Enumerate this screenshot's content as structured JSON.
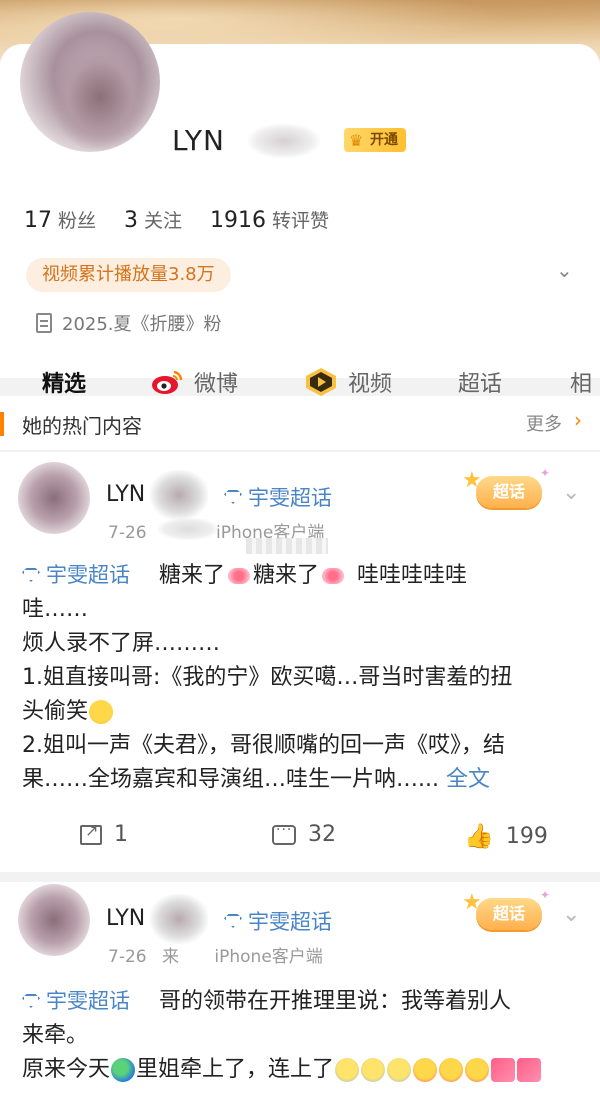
{
  "profile": {
    "username": "LYN",
    "vip_label": "开通",
    "stats": [
      {
        "value": "17",
        "label": "粉丝"
      },
      {
        "value": "3",
        "label": "关注"
      },
      {
        "value": "1916",
        "label": "转评赞"
      }
    ],
    "play_count": "视频累计播放量3.8万",
    "fan_tag": "2025.夏《折腰》粉"
  },
  "tabs": [
    {
      "label": "精选",
      "active": true
    },
    {
      "label": "微博",
      "icon": "weibo-icon"
    },
    {
      "label": "视频",
      "icon": "video-icon"
    },
    {
      "label": "超话"
    },
    {
      "label": "相册"
    }
  ],
  "hot": {
    "title": "她的热门内容",
    "more": "更多"
  },
  "posts": [
    {
      "name": "LYN",
      "topic": "宇雯超话",
      "date": "7-26",
      "source": "iPhone客户端",
      "sticker": "超话",
      "lines": {
        "l1_topic": "宇雯超话",
        "l1_a": "糖来了",
        "l1_b": "糖来了",
        "l1_c": "哇哇哇哇哇",
        "l2": "哇……",
        "l3": "烦人录不了屏………",
        "l4": "1.姐直接叫哥:《我的宁》欧买噶…哥当时害羞的扭",
        "l5": "头偷笑",
        "l6": "2.姐叫一声《夫君》，哥很顺嘴的回一声《哎》，结",
        "l7": "果……全场嘉宾和导演组…哇生一片呐…...",
        "full": "全文"
      },
      "actions": {
        "reposts": "1",
        "comments": "32",
        "likes": "199"
      }
    },
    {
      "name": "LYN",
      "topic": "宇雯超话",
      "date": "7-26",
      "source_prefix": "来",
      "source": "iPhone客户端",
      "sticker": "超话",
      "lines": {
        "l1_topic": "宇雯超话",
        "l1_a": "哥的领带在开推理里说：我等着别人",
        "l2": "来牵。",
        "l3_a": "原来今天",
        "l3_b": "里姐牵上了，连上了"
      }
    }
  ],
  "colors": {
    "accent": "#ff8200",
    "link": "#4a86c6",
    "vip": "#ffbf2f"
  }
}
